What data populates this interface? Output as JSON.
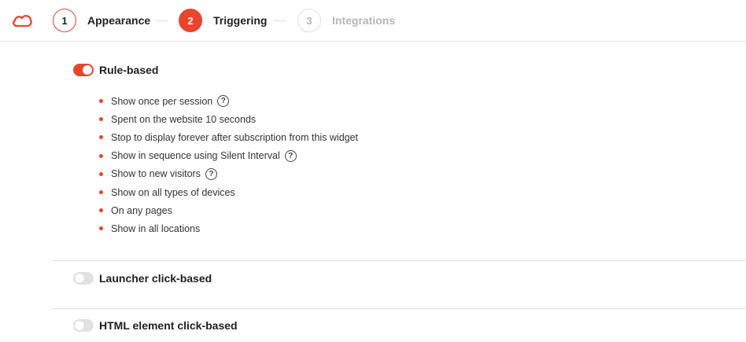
{
  "colors": {
    "accent": "#e8452c",
    "muted": "#b5b5b5",
    "divider": "#e6e6e6"
  },
  "header": {
    "logo_icon": "cloud-logo-icon",
    "steps": [
      {
        "number": "1",
        "label": "Appearance",
        "state": "done"
      },
      {
        "number": "2",
        "label": "Triggering",
        "state": "active"
      },
      {
        "number": "3",
        "label": "Integrations",
        "state": "pending"
      }
    ]
  },
  "triggers": {
    "rule_based": {
      "label": "Rule-based",
      "enabled": true
    },
    "rules": [
      {
        "text": "Show once per session",
        "help": true
      },
      {
        "text": "Spent on the website 10 seconds",
        "help": false
      },
      {
        "text": "Stop to display forever after subscription from this widget",
        "help": false
      },
      {
        "text": "Show in sequence using Silent Interval",
        "help": true
      },
      {
        "text": "Show to new visitors",
        "help": true
      },
      {
        "text": "Show on all types of devices",
        "help": false
      },
      {
        "text": "On any pages",
        "help": false
      },
      {
        "text": "Show in all locations",
        "help": false
      }
    ],
    "help_icon": "?",
    "launcher": {
      "label": "Launcher click-based",
      "enabled": false
    },
    "html_element": {
      "label": "HTML element click-based",
      "enabled": false
    }
  }
}
